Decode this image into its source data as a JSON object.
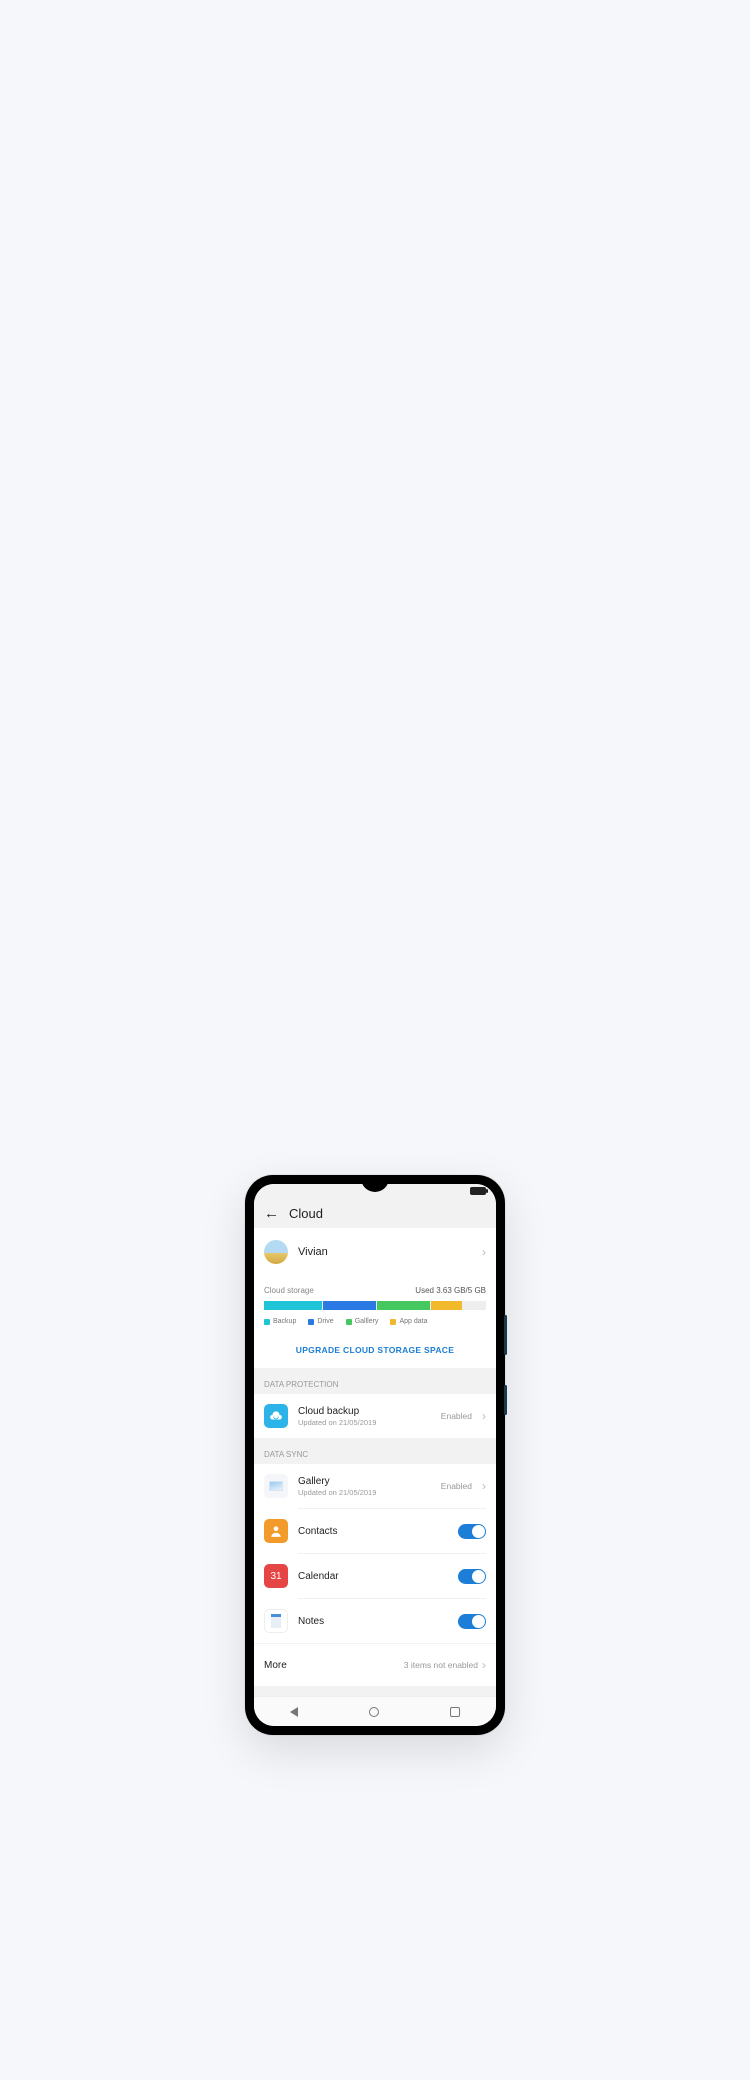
{
  "header": {
    "title": "Cloud"
  },
  "user": {
    "name": "Vivian"
  },
  "storage": {
    "label": "Cloud storage",
    "used": "Used 3.63 GB/5 GB",
    "legend": {
      "backup": "Backup",
      "drive": "Drive",
      "gallery": "Galllery",
      "appdata": "App data"
    },
    "upgrade": "UPGRADE CLOUD STORAGE SPACE"
  },
  "sections": {
    "data_protection": "DATA PROTECTION",
    "data_sync": "DATA SYNC"
  },
  "protection": {
    "cloud_backup": {
      "title": "Cloud backup",
      "sub": "Updated on 21/05/2019",
      "status": "Enabled"
    }
  },
  "sync": {
    "gallery": {
      "title": "Gallery",
      "sub": "Updated on 21/05/2019",
      "status": "Enabled"
    },
    "contacts": {
      "title": "Contacts"
    },
    "calendar": {
      "title": "Calendar",
      "icon_text": "31"
    },
    "notes": {
      "title": "Notes"
    }
  },
  "more": {
    "label": "More",
    "status": "3 items not enabled"
  }
}
